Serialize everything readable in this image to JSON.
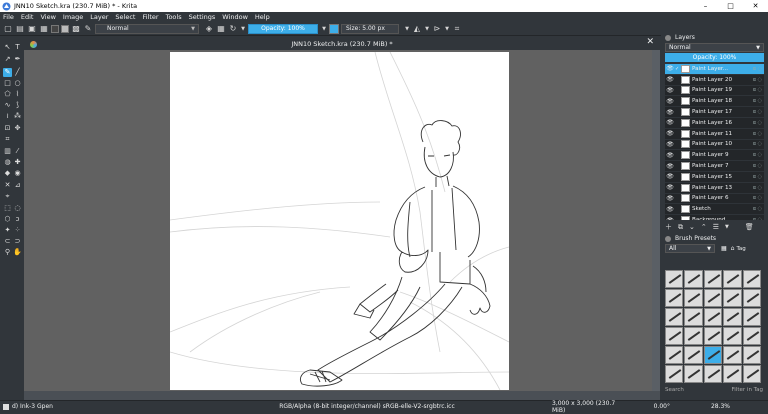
{
  "window": {
    "title": "JNN10 Sketch.kra (230.7 MiB) * - Krita",
    "minimize": "–",
    "maximize": "□",
    "close": "✕"
  },
  "menu": [
    "File",
    "Edit",
    "View",
    "Image",
    "Layer",
    "Select",
    "Filter",
    "Tools",
    "Settings",
    "Window",
    "Help"
  ],
  "toolbar": {
    "blend_mode": "Normal",
    "opacity": "Opacity: 100%",
    "size": "Size: 5.00 px"
  },
  "document": {
    "tab_title": "JNN10 Sketch.kra (230.7 MiB) *"
  },
  "layers_panel": {
    "title": "Layers",
    "blend_mode": "Normal",
    "opacity": "Opacity:  100%",
    "layers": [
      {
        "name": "Paint Layer...",
        "selected": true
      },
      {
        "name": "Paint Layer 20"
      },
      {
        "name": "Paint Layer 19"
      },
      {
        "name": "Paint Layer 18"
      },
      {
        "name": "Paint Layer 17"
      },
      {
        "name": "Paint Layer 16"
      },
      {
        "name": "Paint Layer 11"
      },
      {
        "name": "Paint Layer 10"
      },
      {
        "name": "Paint Layer 9"
      },
      {
        "name": "Paint Layer 7"
      },
      {
        "name": "Paint Layer 15"
      },
      {
        "name": "Paint Layer 13"
      },
      {
        "name": "Paint Layer 6"
      },
      {
        "name": "Sketch"
      },
      {
        "name": "Background"
      }
    ]
  },
  "brush_presets": {
    "title": "Brush Presets",
    "filter": "All",
    "tag": "Tag",
    "search_placeholder": "Search",
    "filter_in_tag": "Filter in Tag"
  },
  "status": {
    "brush": "d) Ink-3 Gpen",
    "color_info": "RGB/Alpha (8-bit integer/channel)  sRGB-elle-V2-srgbtrc.icc",
    "doc_size": "3,000 x 3,000 (230.7 MiB)",
    "rotation": "0.00°",
    "zoom": "28.3%"
  }
}
